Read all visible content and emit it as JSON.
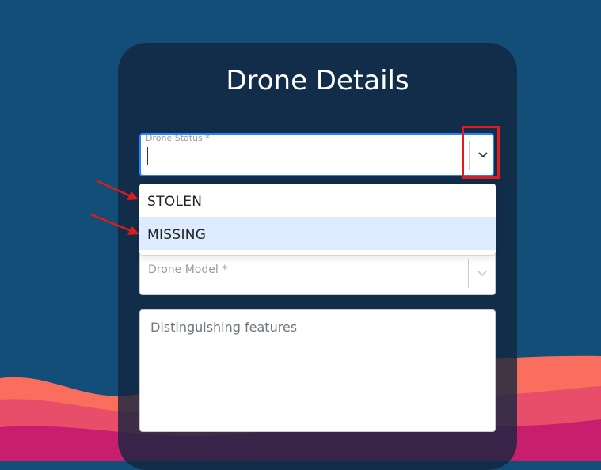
{
  "page": {
    "title": "Drone Details"
  },
  "form": {
    "drone_status": {
      "label": "Drone Status *",
      "value": "",
      "options": [
        "STOLEN",
        "MISSING"
      ],
      "focused_option": "MISSING"
    },
    "drone_model": {
      "placeholder": "Drone Model *"
    },
    "features": {
      "placeholder": "Distinguishing features"
    }
  },
  "icons": {
    "status_dropdown": "chevron-down-icon",
    "model_dropdown": "chevron-down-icon",
    "annotation_arrows": "arrow-right-icon"
  },
  "colors": {
    "background": "#124e78",
    "card": "#13263e",
    "focus_border": "#2684ff",
    "option_focus": "#deebff",
    "annotation": "#e01b1b",
    "wave_light": "#f96e5c",
    "wave_mid": "#e84e6a",
    "wave_dark": "#c81e6e"
  }
}
